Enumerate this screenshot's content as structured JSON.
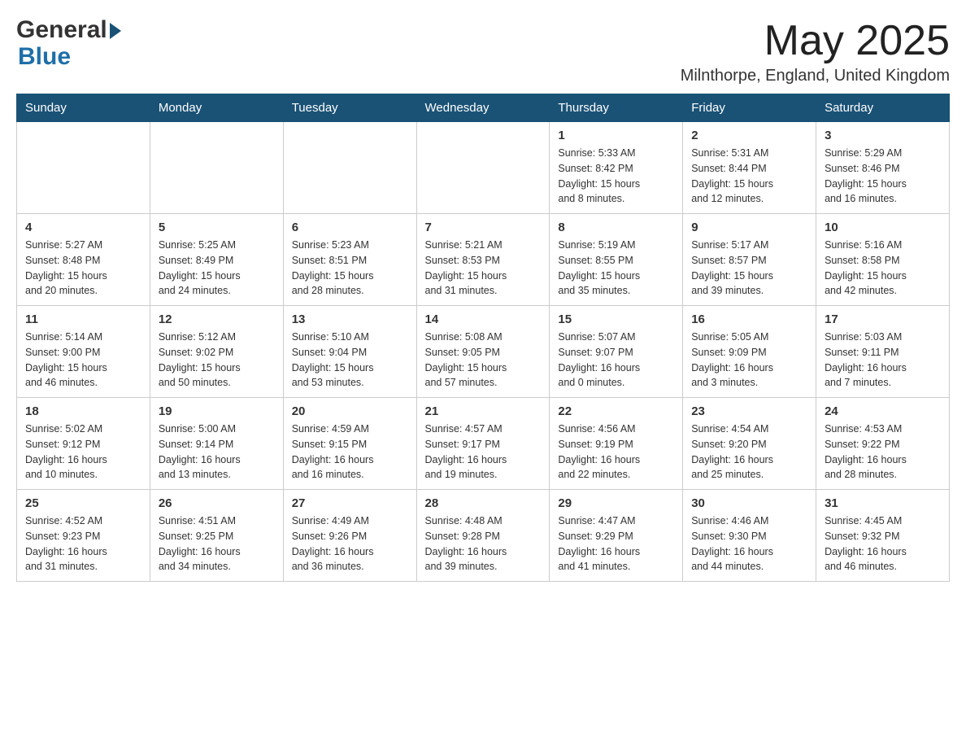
{
  "header": {
    "month_year": "May 2025",
    "location": "Milnthorpe, England, United Kingdom"
  },
  "logo": {
    "general": "General",
    "blue": "Blue"
  },
  "days_of_week": [
    "Sunday",
    "Monday",
    "Tuesday",
    "Wednesday",
    "Thursday",
    "Friday",
    "Saturday"
  ],
  "weeks": [
    [
      {
        "day": "",
        "info": ""
      },
      {
        "day": "",
        "info": ""
      },
      {
        "day": "",
        "info": ""
      },
      {
        "day": "",
        "info": ""
      },
      {
        "day": "1",
        "info": "Sunrise: 5:33 AM\nSunset: 8:42 PM\nDaylight: 15 hours\nand 8 minutes."
      },
      {
        "day": "2",
        "info": "Sunrise: 5:31 AM\nSunset: 8:44 PM\nDaylight: 15 hours\nand 12 minutes."
      },
      {
        "day": "3",
        "info": "Sunrise: 5:29 AM\nSunset: 8:46 PM\nDaylight: 15 hours\nand 16 minutes."
      }
    ],
    [
      {
        "day": "4",
        "info": "Sunrise: 5:27 AM\nSunset: 8:48 PM\nDaylight: 15 hours\nand 20 minutes."
      },
      {
        "day": "5",
        "info": "Sunrise: 5:25 AM\nSunset: 8:49 PM\nDaylight: 15 hours\nand 24 minutes."
      },
      {
        "day": "6",
        "info": "Sunrise: 5:23 AM\nSunset: 8:51 PM\nDaylight: 15 hours\nand 28 minutes."
      },
      {
        "day": "7",
        "info": "Sunrise: 5:21 AM\nSunset: 8:53 PM\nDaylight: 15 hours\nand 31 minutes."
      },
      {
        "day": "8",
        "info": "Sunrise: 5:19 AM\nSunset: 8:55 PM\nDaylight: 15 hours\nand 35 minutes."
      },
      {
        "day": "9",
        "info": "Sunrise: 5:17 AM\nSunset: 8:57 PM\nDaylight: 15 hours\nand 39 minutes."
      },
      {
        "day": "10",
        "info": "Sunrise: 5:16 AM\nSunset: 8:58 PM\nDaylight: 15 hours\nand 42 minutes."
      }
    ],
    [
      {
        "day": "11",
        "info": "Sunrise: 5:14 AM\nSunset: 9:00 PM\nDaylight: 15 hours\nand 46 minutes."
      },
      {
        "day": "12",
        "info": "Sunrise: 5:12 AM\nSunset: 9:02 PM\nDaylight: 15 hours\nand 50 minutes."
      },
      {
        "day": "13",
        "info": "Sunrise: 5:10 AM\nSunset: 9:04 PM\nDaylight: 15 hours\nand 53 minutes."
      },
      {
        "day": "14",
        "info": "Sunrise: 5:08 AM\nSunset: 9:05 PM\nDaylight: 15 hours\nand 57 minutes."
      },
      {
        "day": "15",
        "info": "Sunrise: 5:07 AM\nSunset: 9:07 PM\nDaylight: 16 hours\nand 0 minutes."
      },
      {
        "day": "16",
        "info": "Sunrise: 5:05 AM\nSunset: 9:09 PM\nDaylight: 16 hours\nand 3 minutes."
      },
      {
        "day": "17",
        "info": "Sunrise: 5:03 AM\nSunset: 9:11 PM\nDaylight: 16 hours\nand 7 minutes."
      }
    ],
    [
      {
        "day": "18",
        "info": "Sunrise: 5:02 AM\nSunset: 9:12 PM\nDaylight: 16 hours\nand 10 minutes."
      },
      {
        "day": "19",
        "info": "Sunrise: 5:00 AM\nSunset: 9:14 PM\nDaylight: 16 hours\nand 13 minutes."
      },
      {
        "day": "20",
        "info": "Sunrise: 4:59 AM\nSunset: 9:15 PM\nDaylight: 16 hours\nand 16 minutes."
      },
      {
        "day": "21",
        "info": "Sunrise: 4:57 AM\nSunset: 9:17 PM\nDaylight: 16 hours\nand 19 minutes."
      },
      {
        "day": "22",
        "info": "Sunrise: 4:56 AM\nSunset: 9:19 PM\nDaylight: 16 hours\nand 22 minutes."
      },
      {
        "day": "23",
        "info": "Sunrise: 4:54 AM\nSunset: 9:20 PM\nDaylight: 16 hours\nand 25 minutes."
      },
      {
        "day": "24",
        "info": "Sunrise: 4:53 AM\nSunset: 9:22 PM\nDaylight: 16 hours\nand 28 minutes."
      }
    ],
    [
      {
        "day": "25",
        "info": "Sunrise: 4:52 AM\nSunset: 9:23 PM\nDaylight: 16 hours\nand 31 minutes."
      },
      {
        "day": "26",
        "info": "Sunrise: 4:51 AM\nSunset: 9:25 PM\nDaylight: 16 hours\nand 34 minutes."
      },
      {
        "day": "27",
        "info": "Sunrise: 4:49 AM\nSunset: 9:26 PM\nDaylight: 16 hours\nand 36 minutes."
      },
      {
        "day": "28",
        "info": "Sunrise: 4:48 AM\nSunset: 9:28 PM\nDaylight: 16 hours\nand 39 minutes."
      },
      {
        "day": "29",
        "info": "Sunrise: 4:47 AM\nSunset: 9:29 PM\nDaylight: 16 hours\nand 41 minutes."
      },
      {
        "day": "30",
        "info": "Sunrise: 4:46 AM\nSunset: 9:30 PM\nDaylight: 16 hours\nand 44 minutes."
      },
      {
        "day": "31",
        "info": "Sunrise: 4:45 AM\nSunset: 9:32 PM\nDaylight: 16 hours\nand 46 minutes."
      }
    ]
  ]
}
